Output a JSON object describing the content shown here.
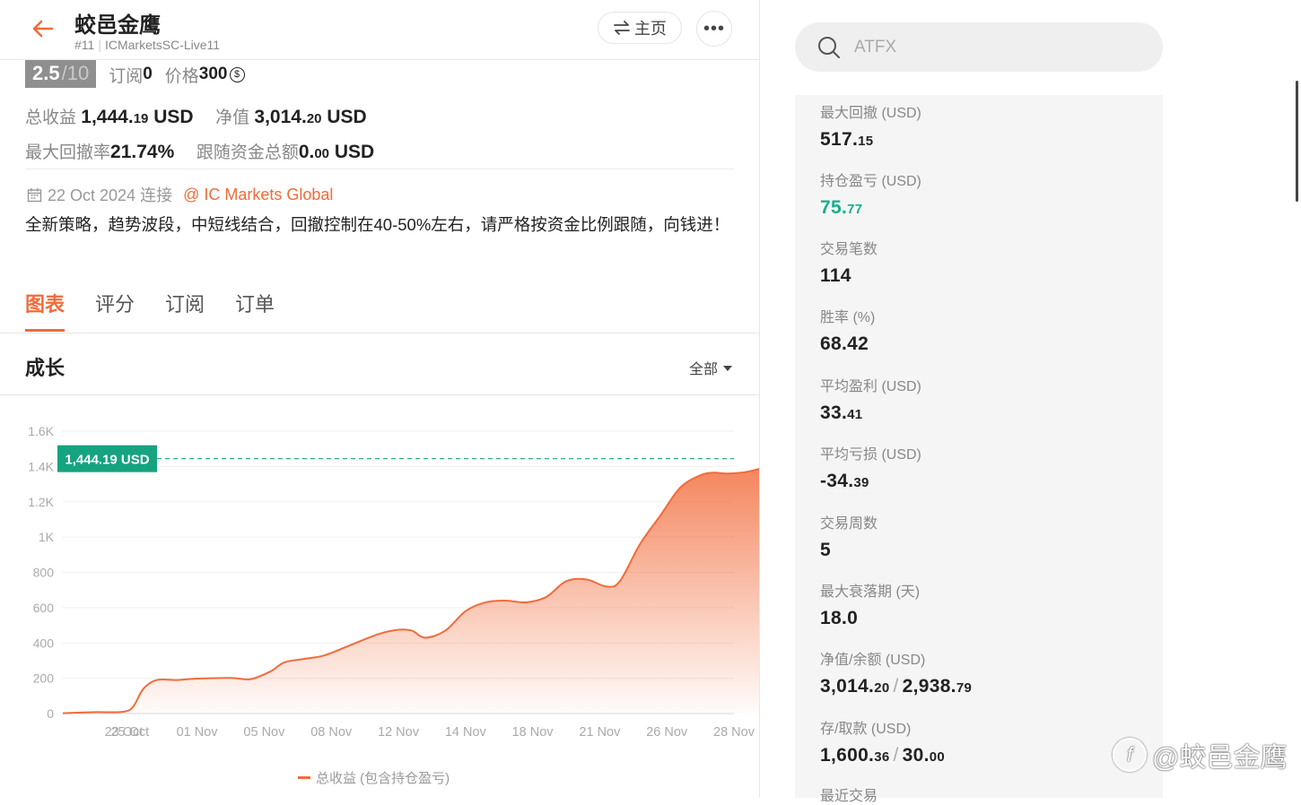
{
  "header": {
    "title": "蛟邑金鹰",
    "rank": "#11",
    "account": "ICMarketsSC-Live11",
    "home_label": "主页",
    "more_label": "•••"
  },
  "rating": {
    "score": "2.5",
    "denominator": "/10",
    "subs_label": "订阅",
    "subs_value": "0",
    "price_label": "价格",
    "price_value": "300",
    "coin_symbol": "$"
  },
  "stats": {
    "total_profit_label": "总收益",
    "total_profit_int": "1,444.",
    "total_profit_dec": "19",
    "total_profit_unit": "USD",
    "equity_label": "净值",
    "equity_int": "3,014.",
    "equity_dec": "20",
    "equity_unit": "USD",
    "drawdown_rate_label": "最大回撤率",
    "drawdown_rate_value": "21.74%",
    "follow_label": "跟随资金总额",
    "follow_int": "0.",
    "follow_dec": "00",
    "follow_unit": "USD"
  },
  "info": {
    "date": "22 Oct 2024 连接",
    "broker": "@ IC Markets Global",
    "description": "全新策略，趋势波段，中短线结合，回撤控制在40-50%左右，请严格按资金比例跟随，向钱进！"
  },
  "tabs": [
    {
      "label": "图表",
      "active": true
    },
    {
      "label": "评分",
      "active": false
    },
    {
      "label": "订阅",
      "active": false
    },
    {
      "label": "订单",
      "active": false
    }
  ],
  "section": {
    "title": "成长",
    "range_label": "全部"
  },
  "chart_data": {
    "type": "area",
    "y_ticks": [
      "0",
      "200",
      "400",
      "600",
      "800",
      "1K",
      "1.2K",
      "1.4K",
      "1.6K"
    ],
    "ylim": [
      0,
      1600
    ],
    "x_ticks": [
      "23 Oct",
      "25 Oct",
      "01 Nov",
      "05 Nov",
      "08 Nov",
      "12 Nov",
      "14 Nov",
      "18 Nov",
      "21 Nov",
      "26 Nov",
      "28 Nov"
    ],
    "current_label": "1,444.19 USD",
    "current_value": 1444.19,
    "legend": "总收益 (包含持仓盈亏)",
    "colors": {
      "line": "#f26b3a",
      "badge": "#16a37f"
    },
    "series": [
      {
        "values": [
          [
            0,
            2
          ],
          [
            0.2,
            5
          ],
          [
            0.5,
            8
          ],
          [
            0.9,
            10
          ],
          [
            1.05,
            40
          ],
          [
            1.2,
            140
          ],
          [
            1.4,
            190
          ],
          [
            1.7,
            190
          ],
          [
            2,
            198
          ],
          [
            2.5,
            202
          ],
          [
            2.8,
            195
          ],
          [
            3.1,
            240
          ],
          [
            3.3,
            290
          ],
          [
            3.6,
            310
          ],
          [
            3.9,
            330
          ],
          [
            4.3,
            390
          ],
          [
            4.7,
            450
          ],
          [
            5,
            475
          ],
          [
            5.2,
            470
          ],
          [
            5.4,
            430
          ],
          [
            5.7,
            470
          ],
          [
            6,
            580
          ],
          [
            6.3,
            630
          ],
          [
            6.6,
            640
          ],
          [
            6.9,
            630
          ],
          [
            7.2,
            660
          ],
          [
            7.5,
            750
          ],
          [
            7.8,
            760
          ],
          [
            8.1,
            720
          ],
          [
            8.3,
            750
          ],
          [
            8.6,
            960
          ],
          [
            8.9,
            1120
          ],
          [
            9.2,
            1280
          ],
          [
            9.5,
            1350
          ],
          [
            9.7,
            1365
          ],
          [
            9.9,
            1360
          ],
          [
            10.2,
            1370
          ],
          [
            10.6,
            1410
          ],
          [
            11,
            1444.19
          ]
        ]
      }
    ]
  },
  "search": {
    "placeholder": "ATFX"
  },
  "metrics": [
    {
      "label": "最大回撤 (USD)",
      "int": "517.",
      "dec": "15"
    },
    {
      "label": "持仓盈亏 (USD)",
      "int": "75.",
      "dec": "77",
      "color": "#16b08a"
    },
    {
      "label": "交易笔数",
      "int": "114",
      "dec": ""
    },
    {
      "label": "胜率 (%)",
      "int": "68.42",
      "dec": ""
    },
    {
      "label": "平均盈利 (USD)",
      "int": "33.",
      "dec": "41"
    },
    {
      "label": "平均亏损 (USD)",
      "int": "-34.",
      "dec": "39"
    },
    {
      "label": "交易周数",
      "int": "5",
      "dec": ""
    },
    {
      "label": "最大衰落期 (天)",
      "int": "18.0",
      "dec": ""
    },
    {
      "label": "净值/余额 (USD)",
      "int": "3,014.",
      "dec": "20",
      "int2": "2,938.",
      "dec2": "79"
    },
    {
      "label": "存/取款 (USD)",
      "int": "1,600.",
      "dec": "36",
      "int2": "30.",
      "dec2": "00"
    },
    {
      "label": "最近交易",
      "int": "",
      "dec": ""
    }
  ],
  "watermark": {
    "text": "@蛟邑金鹰",
    "logo": "f"
  }
}
